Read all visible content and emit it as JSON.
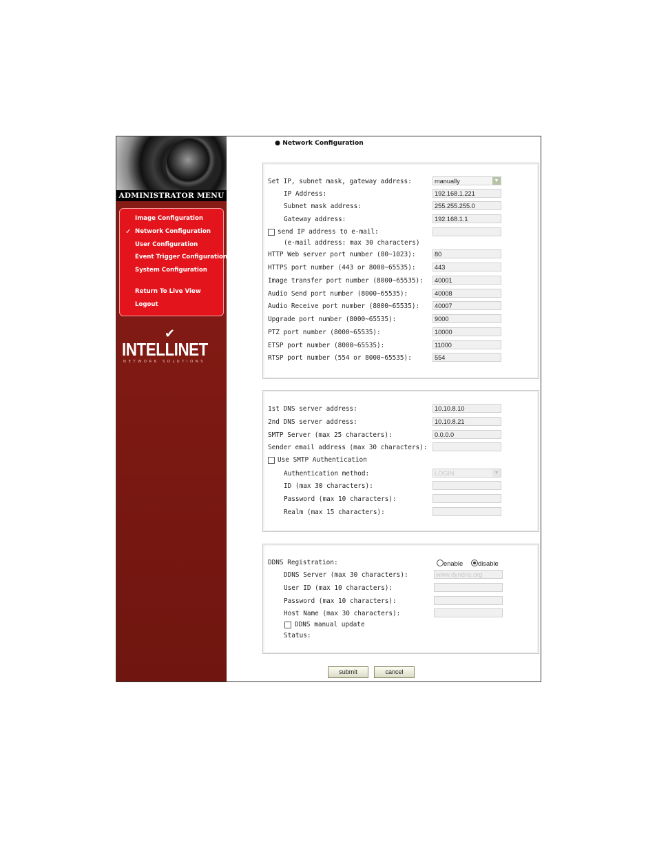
{
  "sidebar": {
    "title": "Administrator Menu",
    "items": [
      {
        "label": "Image Configuration"
      },
      {
        "label": "Network Configuration"
      },
      {
        "label": "User Configuration"
      },
      {
        "label": "Event Trigger Configuration"
      },
      {
        "label": "System Configuration"
      },
      {
        "label": "Return To Live View"
      },
      {
        "label": "Logout"
      }
    ],
    "logo_text": "INTELLINET",
    "logo_sub": "NETWORK SOLUTIONS"
  },
  "page": {
    "title": "● Network Configuration"
  },
  "ip_panel": {
    "mode_label": "Set IP, subnet mask, gateway address:",
    "mode_value": "manually",
    "ip_label": "IP Address:",
    "ip_value": "192.168.1.221",
    "subnet_label": "Subnet mask address:",
    "subnet_value": "255.255.255.0",
    "gateway_label": "Gateway address:",
    "gateway_value": "192.168.1.1",
    "email_label": "send IP address to e-mail:",
    "email_note": "(e-mail address: max 30 characters)",
    "email_value": "",
    "ports": [
      {
        "label": "HTTP Web server port number (80~1023):",
        "value": "80"
      },
      {
        "label": "HTTPS port number (443 or 8000~65535):",
        "value": "443"
      },
      {
        "label": "Image transfer port number (8000~65535):",
        "value": "40001"
      },
      {
        "label": "Audio Send port number (8000~65535):",
        "value": "40008"
      },
      {
        "label": "Audio Receive port number (8000~65535):",
        "value": "40007"
      },
      {
        "label": "Upgrade port number (8000~65535):",
        "value": "9000"
      },
      {
        "label": "PTZ port number (8000~65535):",
        "value": "10000"
      },
      {
        "label": "ETSP port number (8000~65535):",
        "value": "11000"
      },
      {
        "label": "RTSP port number (554 or 8000~65535):",
        "value": "554"
      }
    ]
  },
  "dns_panel": {
    "dns1_label": "1st DNS server address:",
    "dns1_value": "10.10.8.10",
    "dns2_label": "2nd DNS server address:",
    "dns2_value": "10.10.8.21",
    "smtp_label": "SMTP Server (max 25 characters):",
    "smtp_value": "0.0.0.0",
    "sender_label": "Sender email address (max 30 characters):",
    "sender_value": "",
    "auth_cb_label": "Use SMTP Authentication",
    "method_label": "Authentication method:",
    "method_value": "LOGIN",
    "id_label": "ID (max 30 characters):",
    "password_label": "Password (max 10 characters):",
    "realm_label": "Realm (max 15 characters):"
  },
  "ddns_panel": {
    "reg_label": "DDNS Registration:",
    "enable_label": "enable",
    "disable_label": "disable",
    "server_label": "DDNS Server (max 30 characters):",
    "server_value": "www.dyndns.org",
    "userid_label": "User ID (max 10 characters):",
    "password_label": "Password (max 10 characters):",
    "host_label": "Host Name (max 30 characters):",
    "manual_label": "DDNS manual update",
    "status_label": "Status:"
  },
  "buttons": {
    "submit": "submit",
    "cancel": "cancel"
  }
}
